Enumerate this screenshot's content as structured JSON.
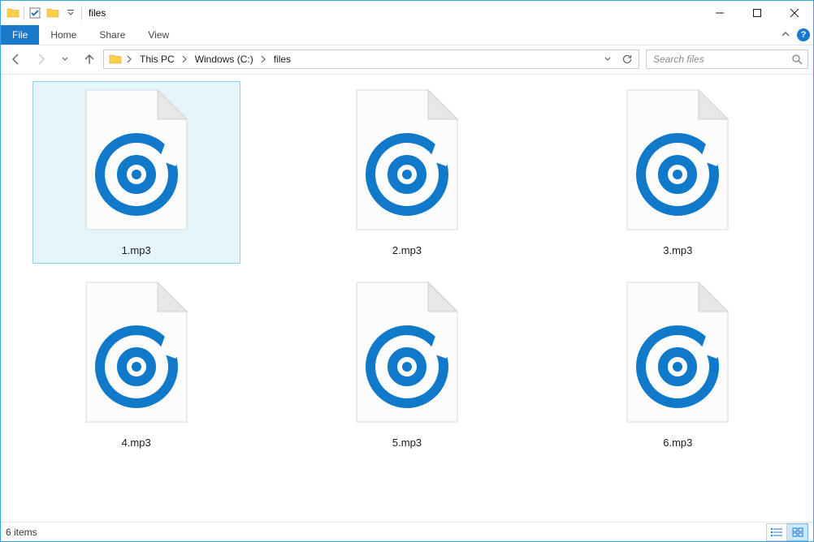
{
  "window": {
    "title": "files"
  },
  "ribbon": {
    "file_label": "File",
    "tabs": [
      "Home",
      "Share",
      "View"
    ]
  },
  "nav": {
    "breadcrumb": [
      "This PC",
      "Windows (C:)",
      "files"
    ],
    "search_placeholder": "Search files"
  },
  "items": [
    {
      "name": "1.mp3",
      "selected": true
    },
    {
      "name": "2.mp3",
      "selected": false
    },
    {
      "name": "3.mp3",
      "selected": false
    },
    {
      "name": "4.mp3",
      "selected": false
    },
    {
      "name": "5.mp3",
      "selected": false
    },
    {
      "name": "6.mp3",
      "selected": false
    }
  ],
  "status": {
    "item_count_label": "6 items"
  }
}
